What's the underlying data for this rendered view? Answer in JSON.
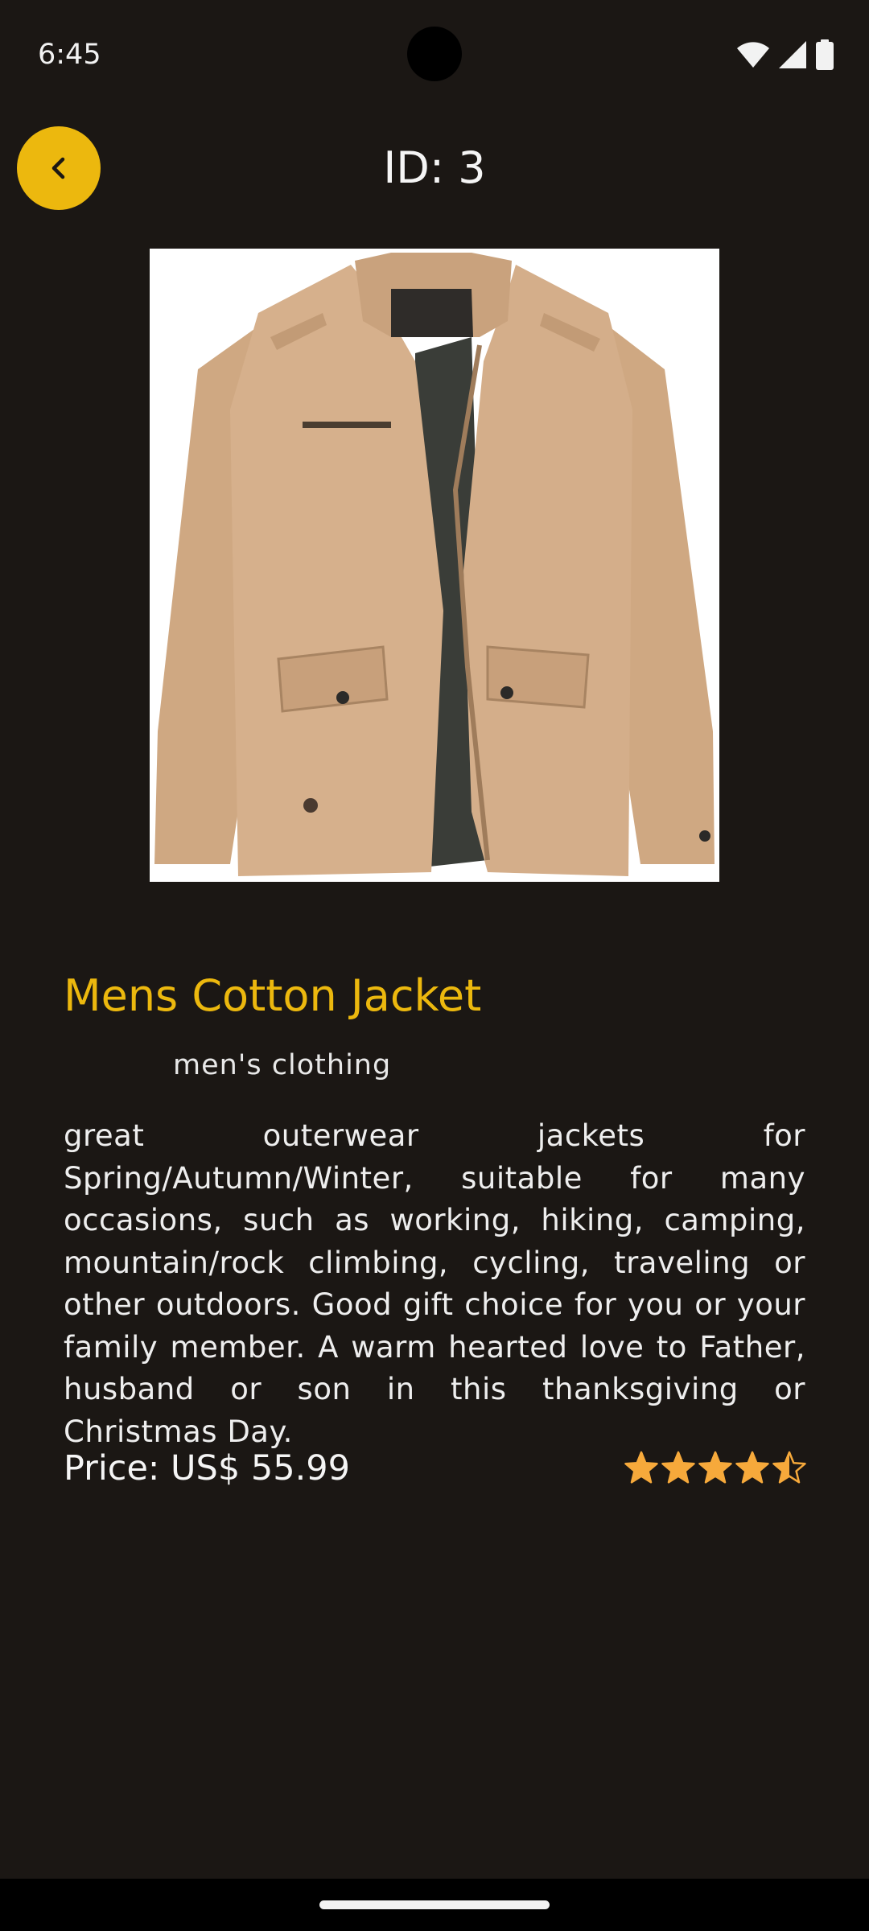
{
  "status_bar": {
    "time": "6:45",
    "icons": [
      "wifi-icon",
      "signal-icon",
      "battery-icon"
    ]
  },
  "header": {
    "title": "ID: 3",
    "back_icon": "chevron-left-icon"
  },
  "product": {
    "image": "tan cotton jacket photo",
    "name": "Mens Cotton Jacket",
    "category": "men's clothing",
    "description": "great outerwear jackets for Spring/Autumn/Winter, suitable for many occasions, such as working, hiking, camping, mountain/rock climbing, cycling, traveling or other outdoors. Good gift choice for you or your family member. A warm hearted love to Father, husband or son in this thanksgiving or Christmas Day.",
    "price_label": "Price: US$ 55.99",
    "rating": 4.5,
    "rating_max": 5
  },
  "colors": {
    "accent": "#ecb80e",
    "background": "#1b1714",
    "star": "#f6a93b"
  }
}
